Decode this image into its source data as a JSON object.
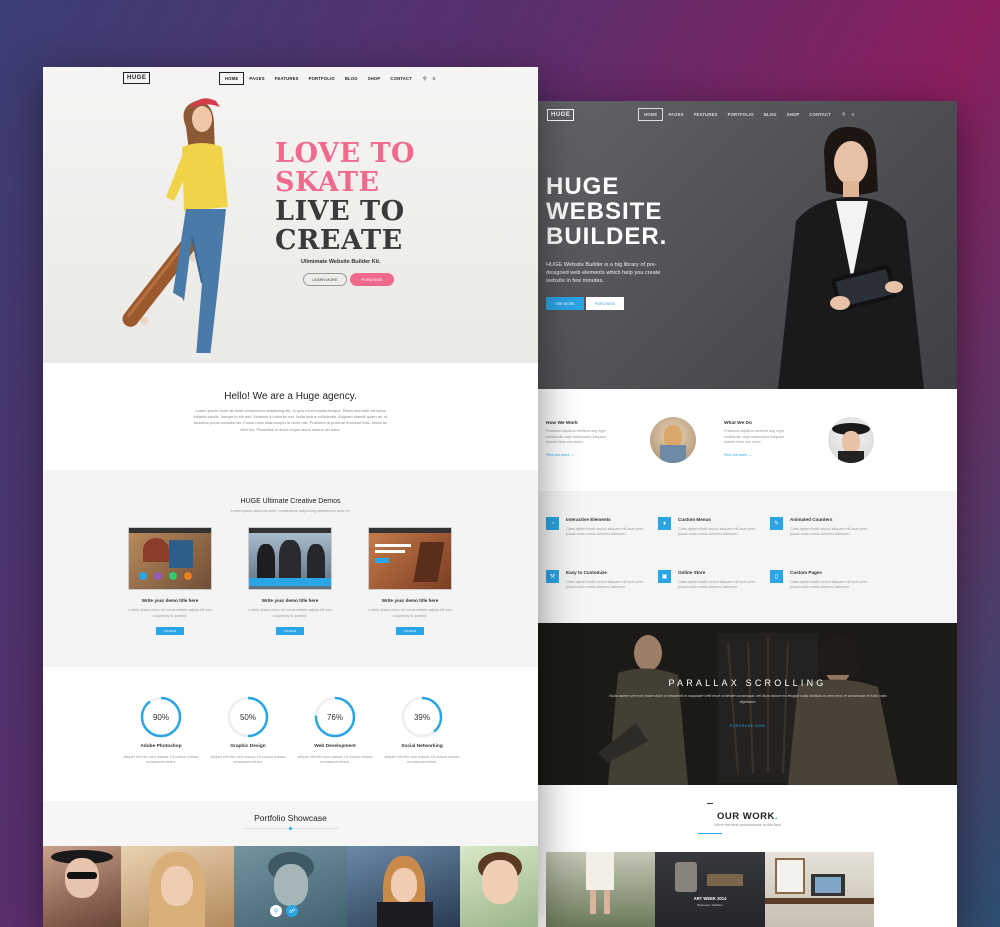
{
  "colors": {
    "accent": "#2aa5e6",
    "pink": "#ef6a8c",
    "dark_text": "#333333"
  },
  "left": {
    "logo": "HUGE",
    "nav": [
      "HOME",
      "PAGES",
      "FEATURES",
      "PORTFOLIO",
      "BLOG",
      "SHOP",
      "CONTACT"
    ],
    "hero": {
      "line1": "LOVE TO",
      "line2": "SKATE",
      "line3": "LIVE TO",
      "line4": "CREATE",
      "subtitle": "Ulimimate Website Builder Kit.",
      "learn_more": "LEARN MORE",
      "purchase": "PURCHASE"
    },
    "about": {
      "title": "Hello! We are a Huge agency.",
      "text": "Lorem ipsum dolor sit amet consectetur adipiscing elit. In quis mi et mauris tempor. Etiam sed nibh vel lacus lobortis iaculis. Integer in elit nisl. Vivamus in lobortis nisi. Nulla luctus sollicitudin. Aliquam blandit quam mi, ut faucibus purus sodales vel. Fusce nunc ullamcorper id dolor nisi. Praesent at pulvinar tincidunt felis. Morbi ac nibh leo. Phasellus in dolor neque lacus cursus vel dolor."
    },
    "demos": {
      "title": "HUGE Ultimate Creative Demos",
      "subtitle": "Lorem ipsum dolor sit amet, consectetur adipiscing elementum ante ex.",
      "items": [
        {
          "title": "Write your demo title here",
          "text": "Lorem ipsum dolor sit consectetuer adipis elit sed nonummy ib scimed.",
          "button": "LAUNCH"
        },
        {
          "title": "Write your demo title here",
          "text": "Lorem ipsum dolor sit consectetuer adipis elit sed nonummy ib scimed.",
          "button": "LAUNCH"
        },
        {
          "title": "Write your demo title here",
          "text": "Lorem ipsum dolor sit consectetuer adipis elit sed nonummy ib scimed.",
          "button": "LAUNCH"
        }
      ]
    },
    "stats": [
      {
        "value": 90,
        "label": "Adobe Photoshop",
        "text": "aliquet elit elim sed massa. Ut cursus massa ornaaescit eleied."
      },
      {
        "value": 50,
        "label": "Graphic Design",
        "text": "aliquet elit elim sed massa. Ut cursus massa ornaaescit eleied."
      },
      {
        "value": 76,
        "label": "Web Development",
        "text": "aliquet elit elim sed massa. Ut cursus massa ornaaescit eleied."
      },
      {
        "value": 39,
        "label": "Social Networking",
        "text": "aliquet elit elim sed massa. Ut cursus massa ornaaescit eleied."
      }
    ],
    "portfolio": {
      "title": "Portfolio Showcase"
    }
  },
  "right": {
    "logo": "HUGE",
    "nav": [
      "HOME",
      "PAGES",
      "FEATURES",
      "PORTFOLIO",
      "BLOG",
      "SHOP",
      "CONTACT"
    ],
    "hero": {
      "line1": "HUGE",
      "line2": "WEBSITE",
      "line3": "BUILDER.",
      "desc": "HUGE Website Builder is a big library of pre-designed web elements which help you create website in few minutes.",
      "see_work": "SEE WORK",
      "purchase": "PURCHASE"
    },
    "how": [
      {
        "title": "How We Work",
        "text": "Praesent dapibus eleifend aug eget sollicitudin adpi malesuada Aliquam blandit illum nec dolor.",
        "link": "Find out more"
      },
      {
        "title": "What We Do",
        "text": "Praesent dapibus eleifend aug eget sollicitudin adpi malesuada Aliquam blandit illum nec dolor.",
        "link": "Find out more"
      }
    ],
    "features": [
      {
        "title": "Interactive Elements",
        "text": "Class aptent taciti sociod aliquam elit auer pers piscal undo omnis dolorem danicum."
      },
      {
        "title": "Custom Menus",
        "text": "Class aptent taciti sociod aliquam elit auer pers piscal undo omnis dolorem danicum."
      },
      {
        "title": "Animated Counters",
        "text": "Class aptent taciti sociod aliquam elit auer pers piscal undo omnis dolorem danicum."
      },
      {
        "title": "Easy to Customize",
        "text": "Class aptent taciti sociod aliquam elit auer pers piscal undo omnis dolorem danicum."
      },
      {
        "title": "Online Store",
        "text": "Class aptent taciti sociod aliquam elit auer pers piscal undo omnis dolorem danicum."
      },
      {
        "title": "Custom Pages",
        "text": "Class aptent taciti sociod aliquam elit auer pers piscal undo omnis dolorem danicum."
      }
    ],
    "parallax": {
      "title": "PARALLAX SCROLLING",
      "text": "Nulla autem vel eum iriure dolor in hendrerit in vulputate velit esse molestie consequat, vel illum dolore eu feugiat nulla facilisis at vero eros et accumsan et iusto odio dignissim.",
      "button": "PURCHASE NOW"
    },
    "ourwork": {
      "title": "OUR WORK",
      "subtitle": "We're the best professionals in this field",
      "caption": "ART WEEK 2014",
      "caption_sub": "Business / Fashion"
    }
  }
}
